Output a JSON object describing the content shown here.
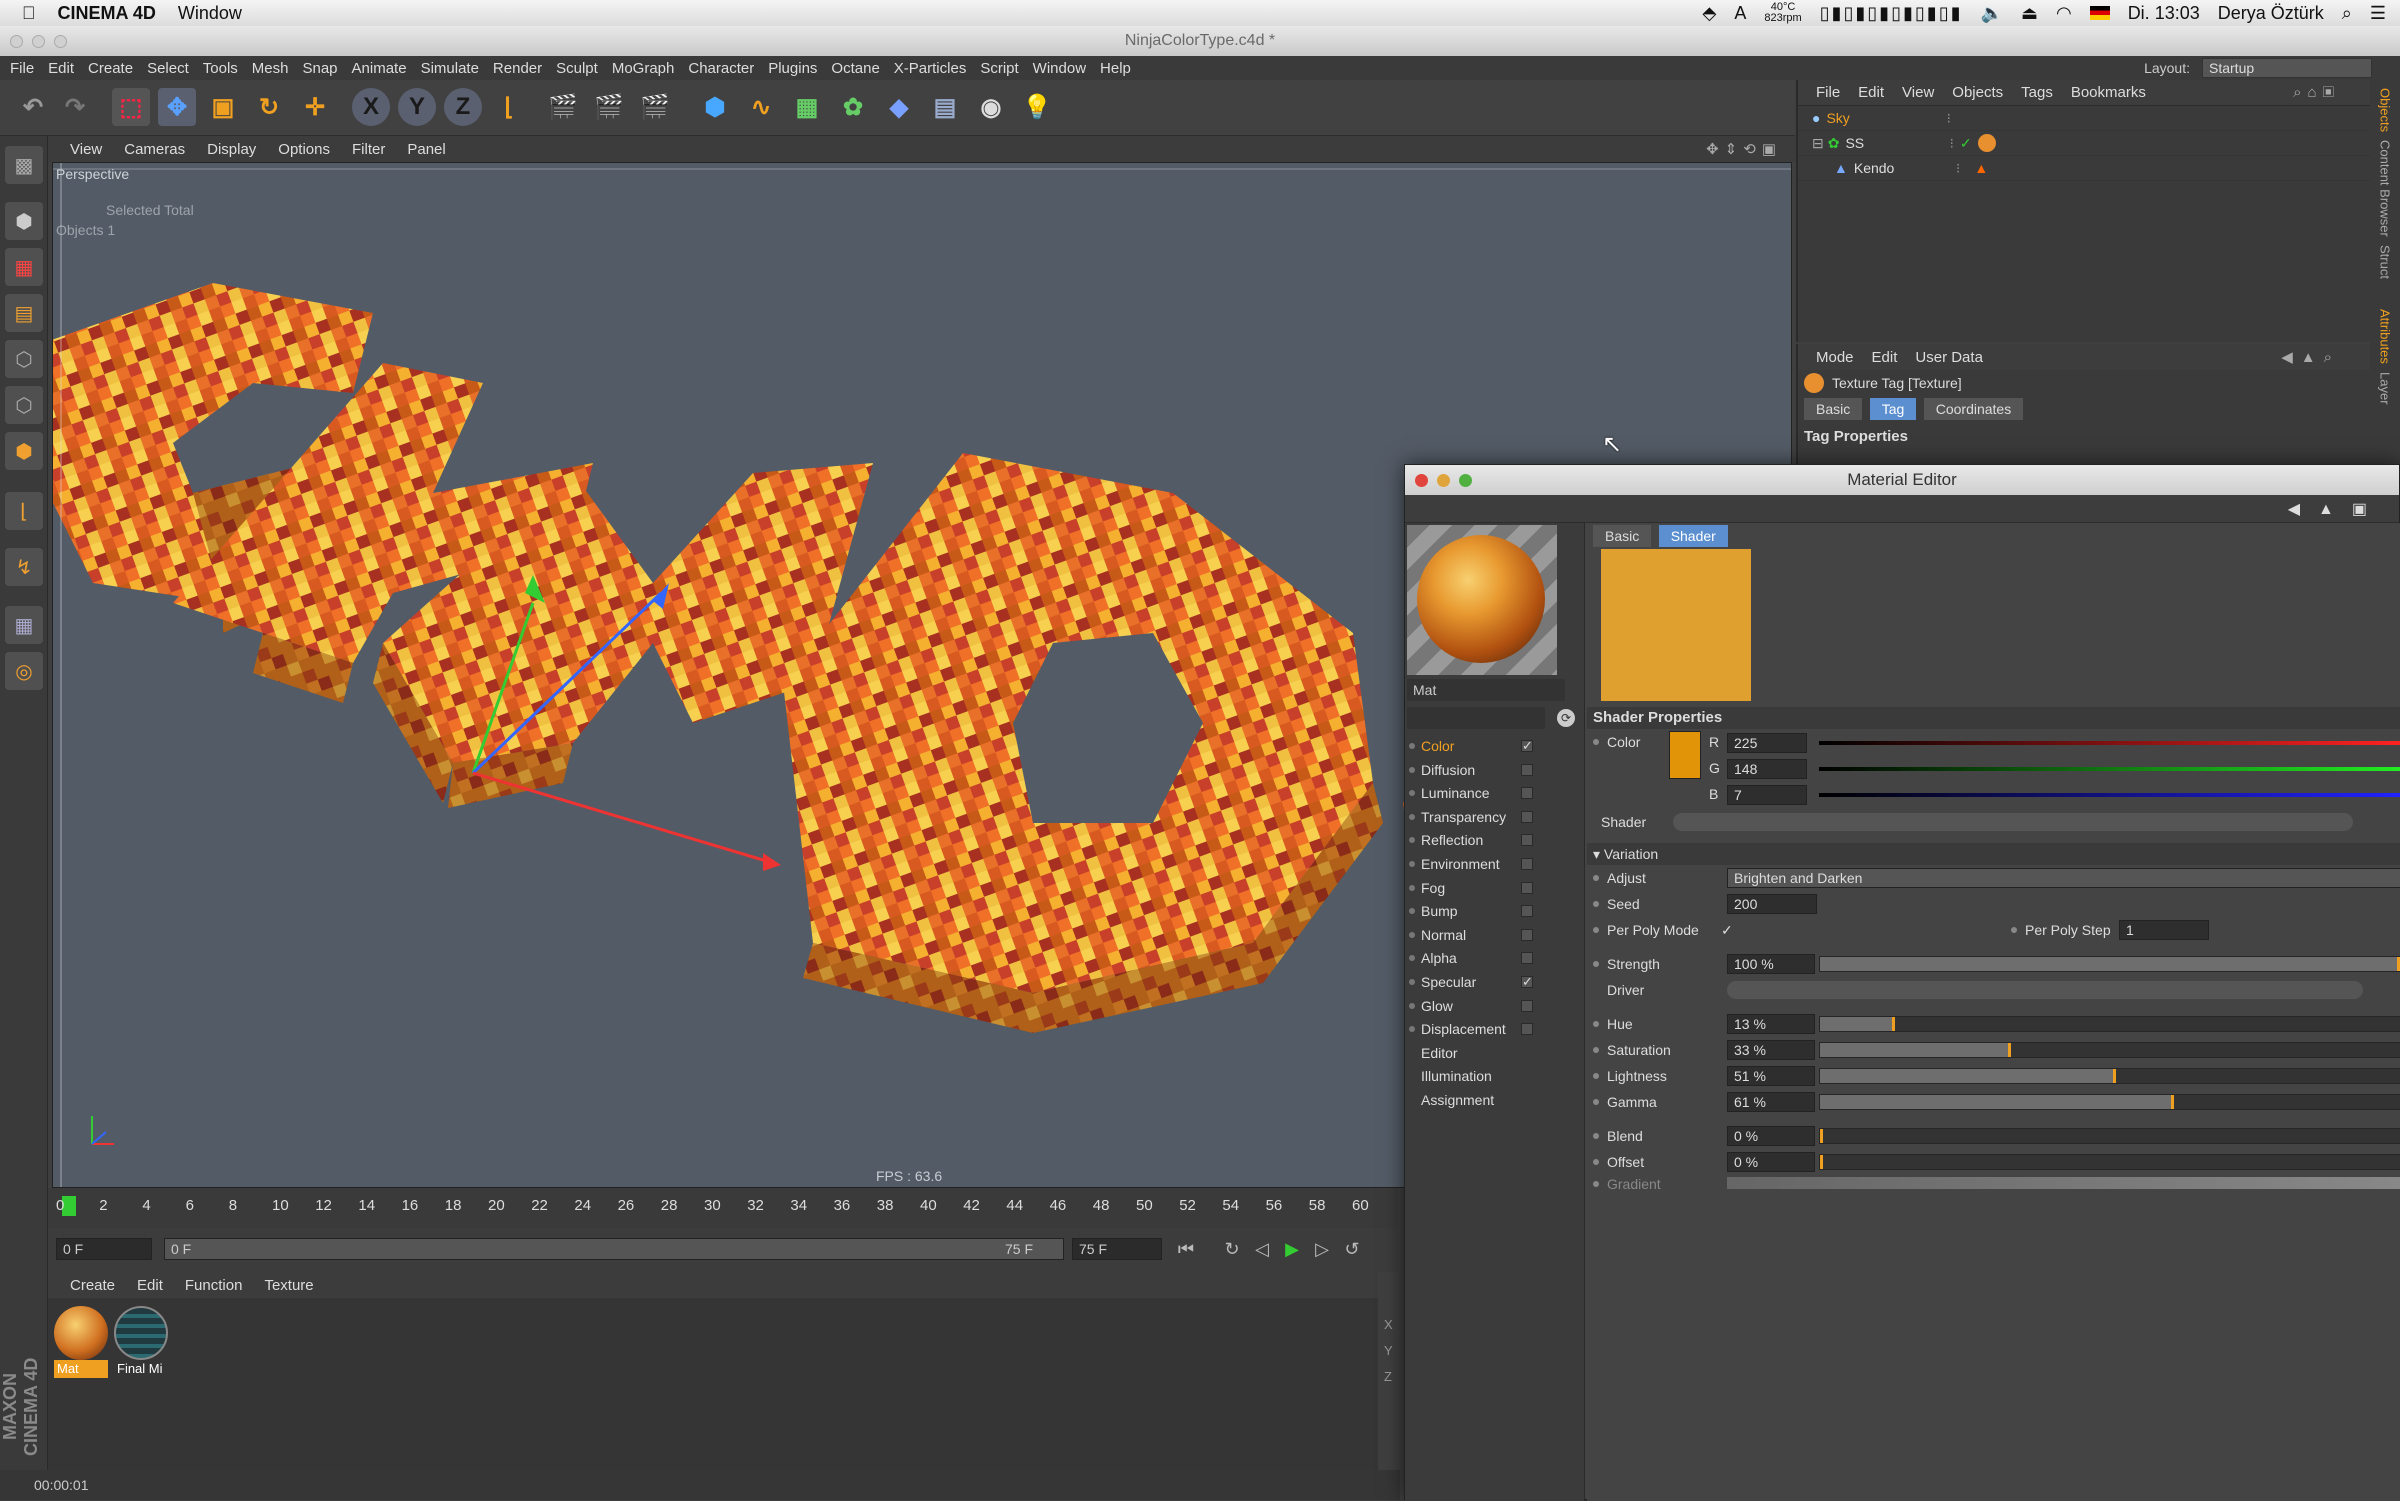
{
  "menubar": {
    "app": "CINEMA 4D",
    "window": "Window",
    "temp": "40°C",
    "rpm": "823rpm",
    "time": "Di. 13:03",
    "user": "Derya Öztürk"
  },
  "window_title": "NinjaColorType.c4d *",
  "main_menu": [
    "File",
    "Edit",
    "Create",
    "Select",
    "Tools",
    "Mesh",
    "Snap",
    "Animate",
    "Simulate",
    "Render",
    "Sculpt",
    "MoGraph",
    "Character",
    "Plugins",
    "Octane",
    "X-Particles",
    "Script",
    "Window",
    "Help"
  ],
  "layout": {
    "label": "Layout:",
    "value": "Startup"
  },
  "toolbar_axes": [
    "X",
    "Y",
    "Z"
  ],
  "viewport": {
    "menu": [
      "View",
      "Cameras",
      "Display",
      "Options",
      "Filter",
      "Panel"
    ],
    "label": "Perspective",
    "overlay_line1": "Selected Total",
    "overlay_line2": "Objects    1",
    "fps": "FPS : 63.6"
  },
  "timeline": {
    "frames": [
      "0",
      "2",
      "4",
      "6",
      "8",
      "10",
      "12",
      "14",
      "16",
      "18",
      "20",
      "22",
      "24",
      "26",
      "28",
      "30",
      "32",
      "34",
      "36",
      "38",
      "40",
      "42",
      "44",
      "46",
      "48",
      "50",
      "52",
      "54",
      "56",
      "58",
      "60"
    ],
    "current": "0 F",
    "start": "0 F",
    "end_slider": "75 F",
    "end": "75 F"
  },
  "material_manager": {
    "menu": [
      "Create",
      "Edit",
      "Function",
      "Texture"
    ],
    "materials": [
      {
        "name": "Mat"
      },
      {
        "name": "Final Mi"
      }
    ],
    "coords": [
      "X",
      "Y",
      "Z"
    ]
  },
  "status": "00:00:01",
  "branding": "MAXON CINEMA 4D",
  "object_manager": {
    "menu": [
      "File",
      "Edit",
      "View",
      "Objects",
      "Tags",
      "Bookmarks"
    ],
    "objects": [
      "Sky",
      "SS",
      "Kendo"
    ]
  },
  "attributes": {
    "menu": [
      "Mode",
      "Edit",
      "User Data"
    ],
    "title": "Texture Tag [Texture]",
    "tabs": [
      "Basic",
      "Tag",
      "Coordinates"
    ],
    "active_tab": "Tag",
    "section": "Tag Properties"
  },
  "right_tabs": [
    "Objects",
    "Content Browser",
    "Struct",
    "Attributes",
    "Layer"
  ],
  "material_editor": {
    "title": "Material Editor",
    "mat_name": "Mat",
    "tabs": [
      "Basic",
      "Shader"
    ],
    "active_tab": "Shader",
    "channels": [
      {
        "name": "Color",
        "checked": "✓"
      },
      {
        "name": "Diffusion",
        "checked": ""
      },
      {
        "name": "Luminance",
        "checked": ""
      },
      {
        "name": "Transparency",
        "checked": ""
      },
      {
        "name": "Reflection",
        "checked": ""
      },
      {
        "name": "Environment",
        "checked": ""
      },
      {
        "name": "Fog",
        "checked": ""
      },
      {
        "name": "Bump",
        "checked": ""
      },
      {
        "name": "Normal",
        "checked": ""
      },
      {
        "name": "Alpha",
        "checked": ""
      },
      {
        "name": "Specular",
        "checked": "✓"
      },
      {
        "name": "Glow",
        "checked": ""
      },
      {
        "name": "Displacement",
        "checked": ""
      },
      {
        "name": "Editor",
        "checked": ""
      },
      {
        "name": "Illumination",
        "checked": ""
      },
      {
        "name": "Assignment",
        "checked": ""
      }
    ],
    "shader_properties": "Shader Properties",
    "color_label": "Color",
    "rgb": {
      "r_label": "R",
      "r": "225",
      "g_label": "G",
      "g": "148",
      "b_label": "B",
      "b": "7"
    },
    "swatch_color": "#e19407",
    "shader_label": "Shader",
    "variation_label": "Variation",
    "adjust_label": "Adjust",
    "adjust_value": "Brighten and Darken",
    "seed_label": "Seed",
    "seed_value": "200",
    "per_poly_mode_label": "Per Poly Mode",
    "per_poly_mode_value": "✓",
    "per_poly_step_label": "Per Poly Step",
    "per_poly_step_value": "1",
    "strength_label": "Strength",
    "strength_value": "100 %",
    "driver_label": "Driver",
    "hue_label": "Hue",
    "hue_value": "13 %",
    "saturation_label": "Saturation",
    "saturation_value": "33 %",
    "lightness_label": "Lightness",
    "lightness_value": "51 %",
    "gamma_label": "Gamma",
    "gamma_value": "61 %",
    "blend_label": "Blend",
    "blend_value": "0 %",
    "offset_label": "Offset",
    "offset_value": "0 %",
    "gradient_label": "Gradient"
  }
}
